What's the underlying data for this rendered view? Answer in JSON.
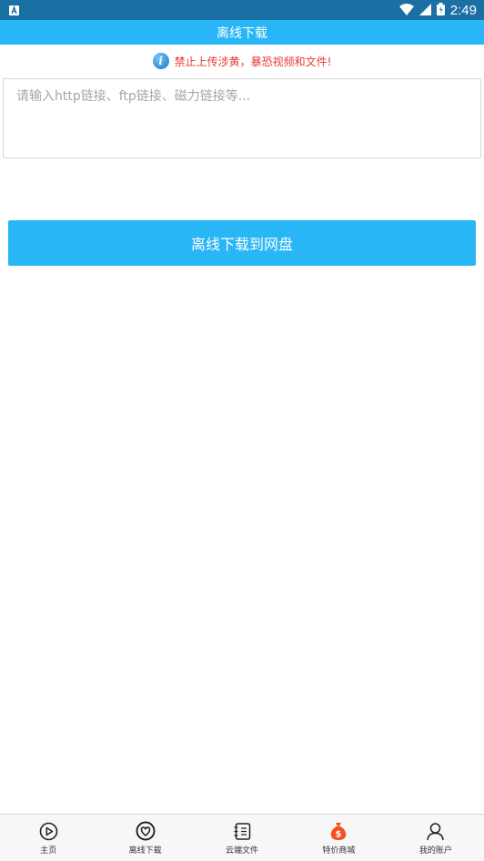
{
  "status_bar": {
    "time": "2:49",
    "notification_icon": "a-box-icon",
    "wifi_icon": "wifi-icon",
    "signal_icon": "signal-icon",
    "battery_icon": "battery-icon"
  },
  "header": {
    "title": "离线下载"
  },
  "notice": {
    "icon": "info-icon",
    "text": "禁止上传涉黄，暴恐视频和文件!"
  },
  "input": {
    "placeholder": "请输入http链接、ftp链接、磁力链接等...",
    "value": ""
  },
  "action": {
    "label": "离线下载到网盘"
  },
  "nav": {
    "items": [
      {
        "label": "主页",
        "icon": "play-circle-icon"
      },
      {
        "label": "离线下载",
        "icon": "heart-circle-icon"
      },
      {
        "label": "云端文件",
        "icon": "notebook-icon"
      },
      {
        "label": "特价商城",
        "icon": "money-bag-icon"
      },
      {
        "label": "我的账户",
        "icon": "user-icon"
      }
    ]
  },
  "colors": {
    "status_bar": "#1a6fa3",
    "primary": "#29b6f6",
    "warning_text": "#e53935",
    "mall_icon": "#f4511e"
  }
}
